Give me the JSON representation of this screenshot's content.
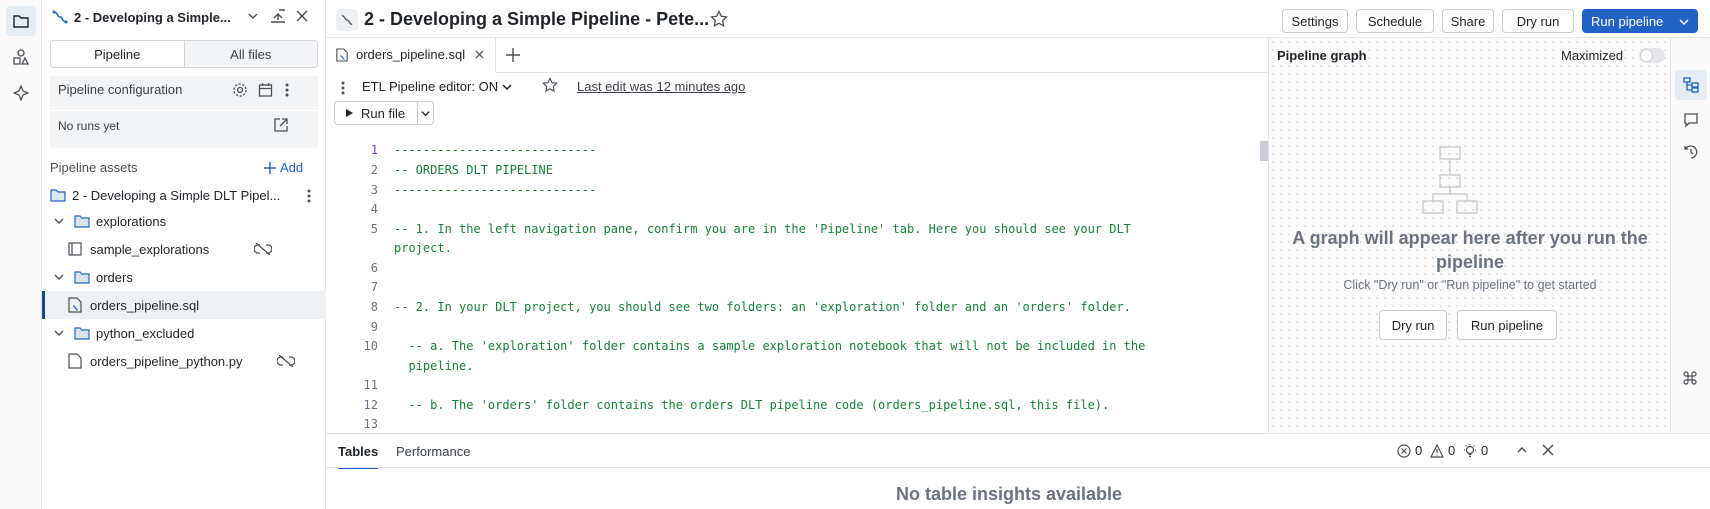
{
  "left_panel": {
    "title": "2 - Developing a Simple...",
    "tabs": [
      "Pipeline",
      "All files"
    ],
    "config_label": "Pipeline configuration",
    "runs_label": "No runs yet",
    "assets_label": "Pipeline assets",
    "add_label": "Add",
    "tree": [
      {
        "label": "2 - Developing a Simple DLT Pipel...",
        "type": "pipeline-folder"
      },
      {
        "label": "explorations",
        "type": "folder"
      },
      {
        "label": "sample_explorations",
        "type": "notebook"
      },
      {
        "label": "orders",
        "type": "folder"
      },
      {
        "label": "orders_pipeline.sql",
        "type": "file"
      },
      {
        "label": "python_excluded",
        "type": "folder"
      },
      {
        "label": "orders_pipeline_python.py",
        "type": "file"
      }
    ]
  },
  "topbar": {
    "title": "2 - Developing a Simple Pipeline - Pete...",
    "buttons": {
      "settings": "Settings",
      "schedule": "Schedule",
      "share": "Share",
      "dry_run": "Dry run",
      "run_pipeline": "Run pipeline"
    }
  },
  "editor": {
    "tab_label": "orders_pipeline.sql",
    "mode_label": "ETL Pipeline editor: ON",
    "last_edit": "Last edit was 12 minutes ago",
    "run_file": "Run file",
    "lines": [
      {
        "n": "1",
        "t": "----------------------------"
      },
      {
        "n": "2",
        "t": "-- ORDERS DLT PIPELINE"
      },
      {
        "n": "3",
        "t": "----------------------------"
      },
      {
        "n": "4",
        "t": ""
      },
      {
        "n": "5",
        "t": "-- 1. In the left navigation pane, confirm you are in the 'Pipeline' tab. Here you should see your DLT"
      },
      {
        "n": "",
        "t": "project."
      },
      {
        "n": "6",
        "t": ""
      },
      {
        "n": "7",
        "t": ""
      },
      {
        "n": "8",
        "t": "-- 2. In your DLT project, you should see two folders: an 'exploration' folder and an 'orders' folder."
      },
      {
        "n": "9",
        "t": ""
      },
      {
        "n": "10",
        "t": "  -- a. The 'exploration' folder contains a sample exploration notebook that will not be included in the"
      },
      {
        "n": "",
        "t": "  pipeline."
      },
      {
        "n": "11",
        "t": ""
      },
      {
        "n": "12",
        "t": "  -- b. The 'orders' folder contains the orders DLT pipeline code (orders_pipeline.sql, this file)."
      },
      {
        "n": "13",
        "t": ""
      }
    ]
  },
  "graph": {
    "title": "Pipeline graph",
    "maximized": "Maximized",
    "empty_title": "A graph will appear here after you run the pipeline",
    "empty_sub": "Click \"Dry run\" or \"Run pipeline\" to get started",
    "dry_run": "Dry run",
    "run_pipeline": "Run pipeline"
  },
  "bottom": {
    "tabs": [
      "Tables",
      "Performance"
    ],
    "errors": "0",
    "warnings": "0",
    "hints": "0",
    "empty": "No table insights available"
  },
  "colors": {
    "accent": "#2063c4",
    "code_green": "#188038"
  }
}
